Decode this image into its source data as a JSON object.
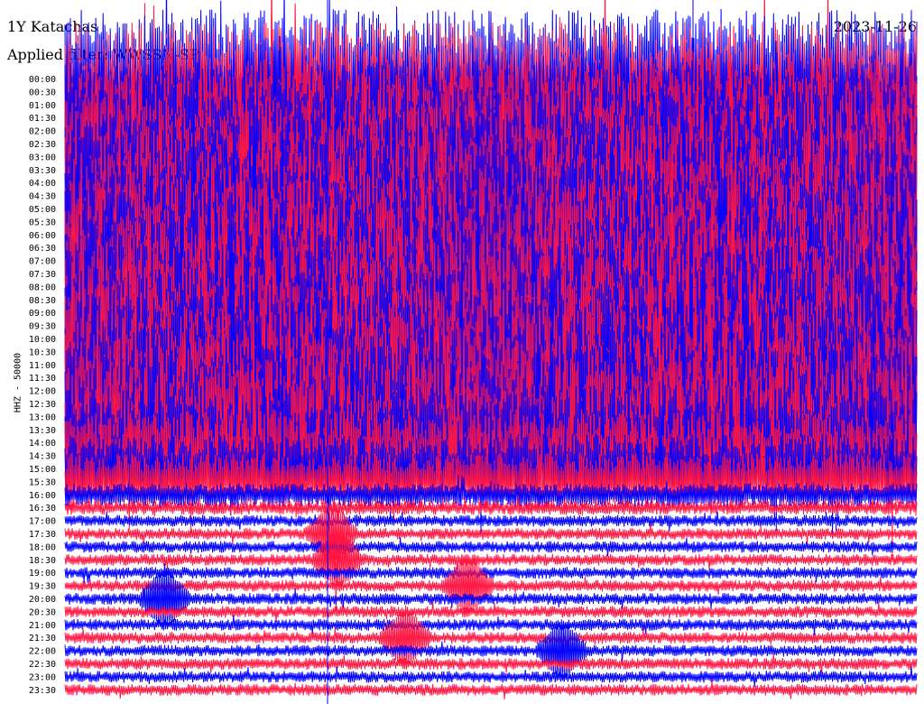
{
  "header": {
    "station": "1Y Katachas",
    "filter_label": "Applied filter: WWSSN-SP",
    "date": "2023-11-26"
  },
  "axis_label": "HHZ - 50000",
  "colors": {
    "trace_a": "#0000ff",
    "trace_b": "#ff1744",
    "background": "#ffffff",
    "text": "#000000"
  },
  "chart_data": {
    "type": "helicorder",
    "row_minutes": 30,
    "x_range_minutes": [
      0,
      30
    ],
    "row_labels": [
      "00:00",
      "00:30",
      "01:00",
      "01:30",
      "02:00",
      "02:30",
      "03:00",
      "03:30",
      "04:00",
      "04:30",
      "05:00",
      "05:30",
      "06:00",
      "06:30",
      "07:00",
      "07:30",
      "08:00",
      "08:30",
      "09:00",
      "09:30",
      "10:00",
      "10:30",
      "11:00",
      "11:30",
      "12:00",
      "12:30",
      "13:00",
      "13:30",
      "14:00",
      "14:30",
      "15:00",
      "15:30",
      "16:00",
      "16:30",
      "17:00",
      "17:30",
      "18:00",
      "18:30",
      "19:00",
      "19:30",
      "20:00",
      "20:30",
      "21:00",
      "21:30",
      "22:00",
      "22:30",
      "23:00",
      "23:30"
    ],
    "row_amplitude": [
      6,
      6,
      6,
      6,
      6,
      6,
      6,
      6,
      6,
      6,
      6,
      6,
      6,
      6,
      6,
      6,
      6,
      6,
      6,
      6,
      6,
      6,
      6,
      6,
      6,
      6,
      6,
      6,
      5,
      4,
      3,
      2.5,
      1,
      0.6,
      0.5,
      0.5,
      0.5,
      0.5,
      0.5,
      0.5,
      0.5,
      0.5,
      0.5,
      0.5,
      0.5,
      0.5,
      0.5,
      0.5
    ],
    "events_minutes": [
      {
        "row": 35,
        "minute": 9.4
      },
      {
        "row": 37,
        "minute": 9.6
      },
      {
        "row": 39,
        "minute": 14.2
      },
      {
        "row": 40,
        "minute": 3.5
      },
      {
        "row": 43,
        "minute": 12.0
      },
      {
        "row": 44,
        "minute": 17.5
      }
    ]
  }
}
